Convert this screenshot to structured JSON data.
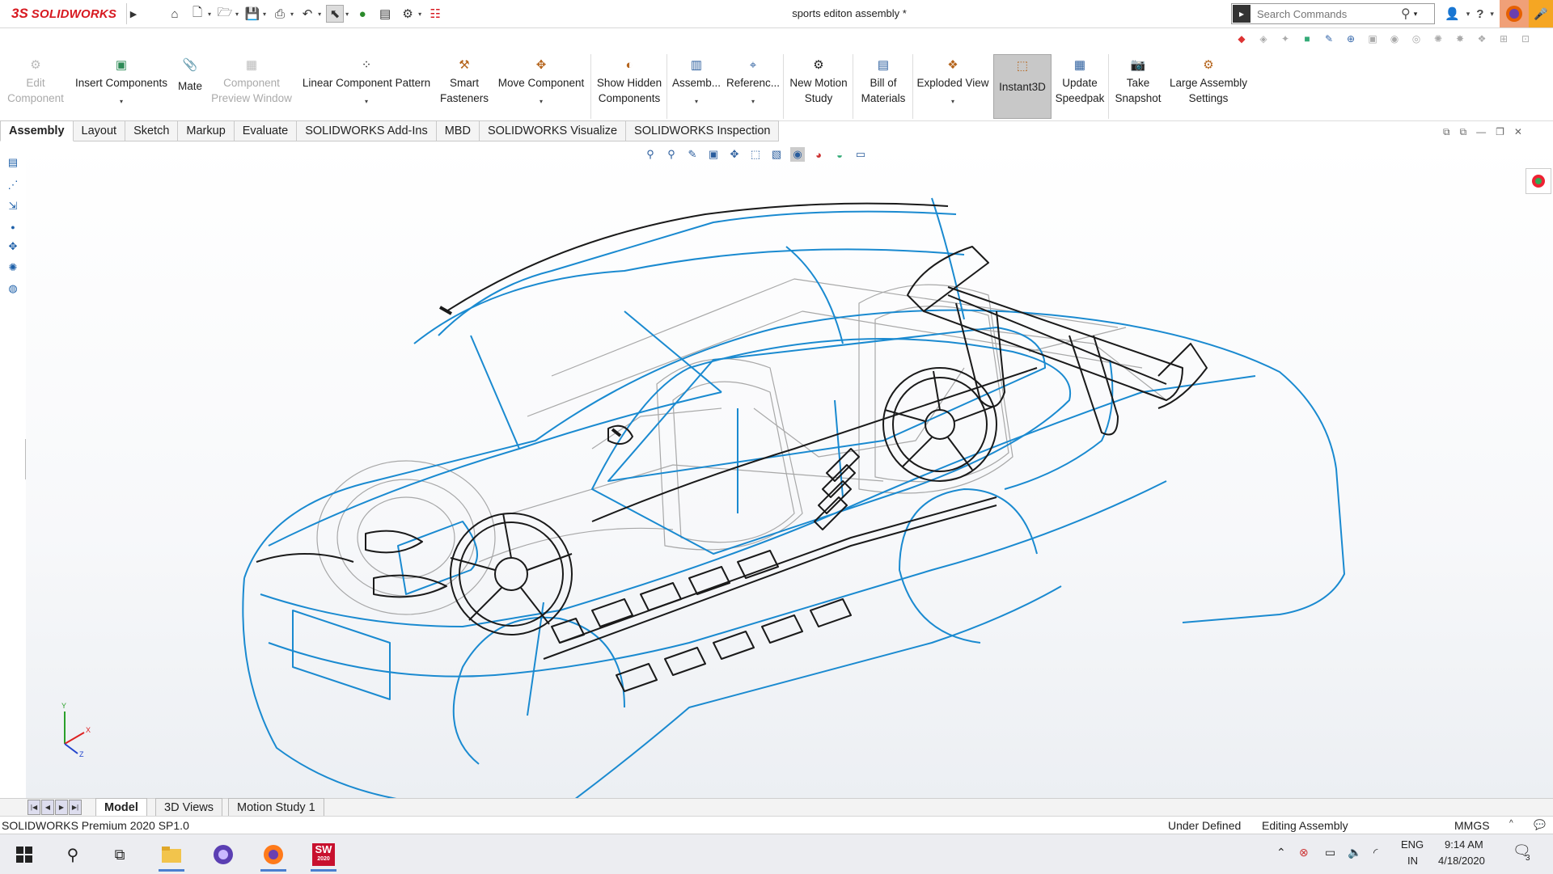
{
  "app": {
    "logo_ds": "3S",
    "logo_text": "SOLIDWORKS",
    "document_title": "sports editon assembly *"
  },
  "search": {
    "placeholder": "Search Commands"
  },
  "command_manager": {
    "buttons": [
      {
        "label1": "Edit",
        "label2": "Component",
        "icon": "edit-component-icon",
        "disabled": true
      },
      {
        "label1": "Insert Components",
        "label2": "",
        "icon": "insert-components-icon",
        "caret": true
      },
      {
        "label1": "Mate",
        "label2": "",
        "icon": "mate-icon"
      },
      {
        "label1": "Component",
        "label2": "Preview Window",
        "icon": "component-preview-icon",
        "disabled": true
      },
      {
        "label1": "Linear Component Pattern",
        "label2": "",
        "icon": "linear-pattern-icon",
        "caret": true
      },
      {
        "label1": "Smart",
        "label2": "Fasteners",
        "icon": "smart-fasteners-icon"
      },
      {
        "label1": "Move Component",
        "label2": "",
        "icon": "move-component-icon",
        "caret": true
      },
      {
        "label1": "Show Hidden",
        "label2": "Components",
        "icon": "show-hidden-icon"
      },
      {
        "label1": "Assemb...",
        "label2": "",
        "icon": "assembly-features-icon",
        "caret": true
      },
      {
        "label1": "Referenc...",
        "label2": "",
        "icon": "reference-geometry-icon",
        "caret": true
      },
      {
        "label1": "New Motion",
        "label2": "Study",
        "icon": "motion-study-icon"
      },
      {
        "label1": "Bill of",
        "label2": "Materials",
        "icon": "bom-icon"
      },
      {
        "label1": "Exploded View",
        "label2": "",
        "icon": "exploded-view-icon",
        "caret": true
      },
      {
        "label1": "Instant3D",
        "label2": "",
        "icon": "instant3d-icon",
        "active": true
      },
      {
        "label1": "Update",
        "label2": "Speedpak",
        "icon": "speedpak-icon"
      },
      {
        "label1": "Take",
        "label2": "Snapshot",
        "icon": "snapshot-icon"
      },
      {
        "label1": "Large Assembly",
        "label2": "Settings",
        "icon": "large-assembly-icon"
      }
    ]
  },
  "tabs": [
    "Assembly",
    "Layout",
    "Sketch",
    "Markup",
    "Evaluate",
    "SOLIDWORKS Add-Ins",
    "MBD",
    "SOLIDWORKS Visualize",
    "SOLIDWORKS Inspection"
  ],
  "model_tabs": [
    "Model",
    "3D Views",
    "Motion Study 1"
  ],
  "triad": {
    "y": "Y",
    "x": "X",
    "z": "Z"
  },
  "status": {
    "version": "SOLIDWORKS Premium 2020 SP1.0",
    "definition": "Under Defined",
    "mode": "Editing Assembly",
    "units": "MMGS",
    "units_caret": "^"
  },
  "taskbar": {
    "lang1": "ENG",
    "lang2": "IN",
    "time": "9:14 AM",
    "date": "4/18/2020",
    "notif_count": "3",
    "sw_badge": "2020"
  },
  "colors": {
    "accent": "#d71920",
    "wire_blue": "#1a8ad0",
    "wire_dark": "#1a1a1a",
    "wire_grey": "#9a9a9a"
  }
}
